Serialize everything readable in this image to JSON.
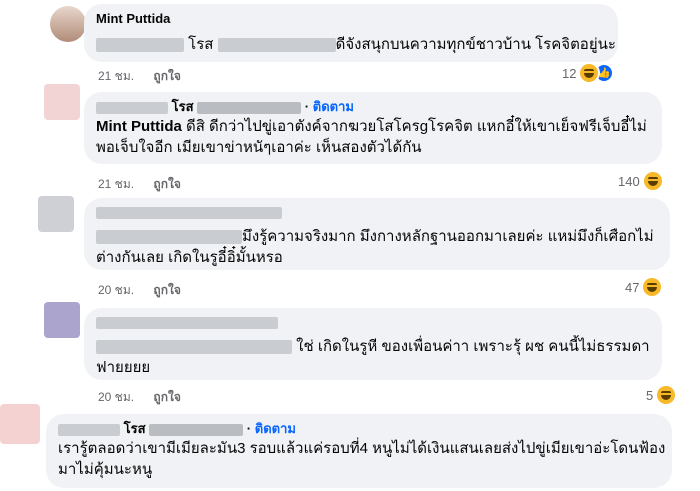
{
  "comments": [
    {
      "author": "Mint Puttida",
      "text_a": "โรส",
      "text_b": "ดีจังสนุกบนความทุกข์ชาวบ้าน โรคจิตอยู่นะ",
      "time": "21 ชม.",
      "like": "ถูกใจ",
      "count": "12"
    },
    {
      "author_suffix": "โรส",
      "follow": "ติดตาม",
      "mention": "Mint Puttida",
      "text_line1": " ดีสิ ดีกว่าไปขู่เอาตังค์จากฆวยโสโครgโรคจิต แหกอี๋ให้เขาเย็จฟรีเจ็บอี๋ไม่",
      "text_line2": "พอเจ็บใจอีก เมียเขาข่าหนัๆเอาค่ะ เห็นสองตัวได้กัน",
      "time": "21 ชม.",
      "like": "ถูกใจ",
      "count": "140"
    },
    {
      "text_line1": "มึงรู้ความจริงมาก มึงกางหลักฐานออกมาเลยค่ะ แหม่มึงก็เศือกไม่",
      "text_line2": "ต่างกันเลย เกิดในรูอี๋อิ๋มั้นหรอ",
      "time": "20 ชม.",
      "like": "ถูกใจ",
      "count": "47"
    },
    {
      "text_line1": "ใช่ เกิดในรูหี ของเพื่อนค่าา เพราะรุ้ ผช คนนี้ไม่ธรรมดา",
      "text_line2": "ฟายยยย",
      "time": "20 ชม.",
      "like": "ถูกใจ",
      "count": "5"
    },
    {
      "author_suffix": "โรส",
      "follow": "ติดตาม",
      "text_line1": "เรารู้ตลอดว่าเขามีเมียละมัน3 รอบแล้วแค่รอบที่4 หนูไม่ได้เงินแสนเลยส่งไปขู่เมียเขาอ่ะโดนฟ้อง",
      "text_line2": "มาไม่คุ้มนะหนู"
    }
  ],
  "dot": "·",
  "icons": [
    "laugh-reaction-icon",
    "like-reaction-icon",
    "avatar"
  ]
}
